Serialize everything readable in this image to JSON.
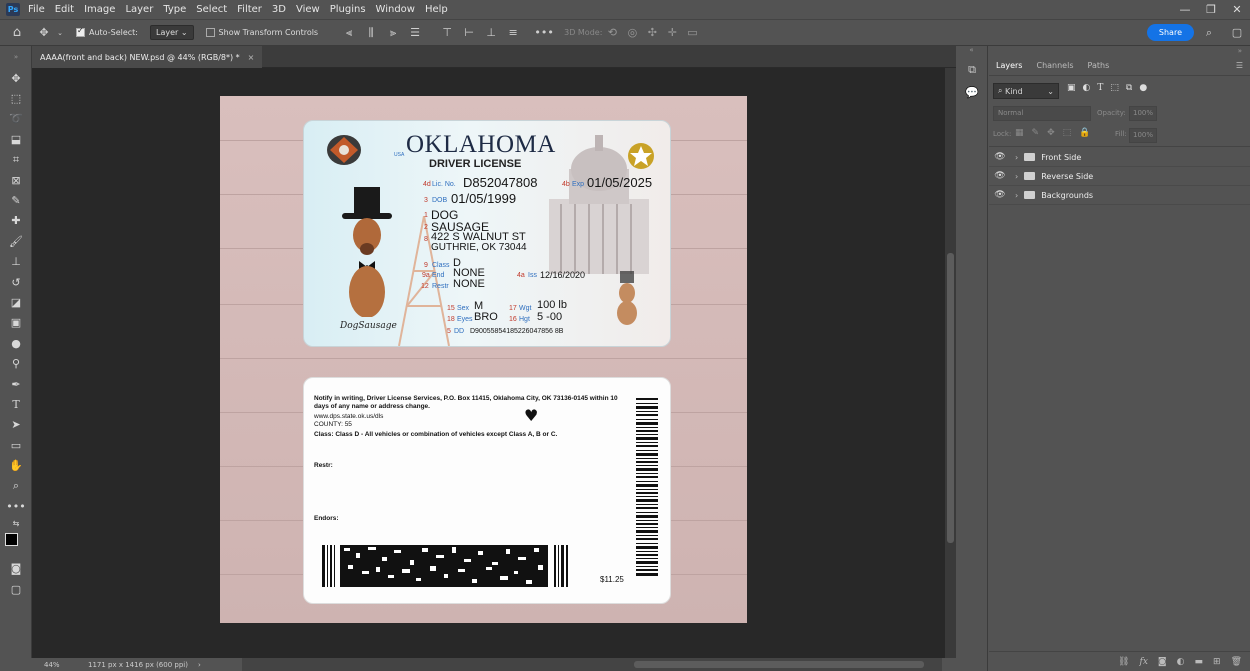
{
  "app": {
    "logo": "Ps"
  },
  "menu": [
    "File",
    "Edit",
    "Image",
    "Layer",
    "Type",
    "Select",
    "Filter",
    "3D",
    "View",
    "Plugins",
    "Window",
    "Help"
  ],
  "window_controls": [
    "—",
    "❐",
    "✕"
  ],
  "options": {
    "auto_select_label": "Auto-Select:",
    "auto_select_value": "Layer",
    "transform_label": "Show Transform Controls",
    "mode_3d": "3D Mode:",
    "share": "Share",
    "more": "•••"
  },
  "document": {
    "tab_title": "AAAA(front and back) NEW.psd @ 44% (RGB/8*) *",
    "close": "×"
  },
  "status": {
    "zoom": "44%",
    "dimensions": "1171 px x 1416 px (600 ppi)",
    "arrow": "›"
  },
  "id_front": {
    "state": "OKLAHOMA",
    "usa": "USA",
    "subtitle": "DRIVER LICENSE",
    "lic_num_code": "4d",
    "lic_label": "Lic. No.",
    "lic_no": "D852047808",
    "exp_code": "4b",
    "exp_label": "Exp",
    "exp": "01/05/2025",
    "dob_code": "3",
    "dob_label": "DOB",
    "dob": "01/05/1999",
    "n1": "1",
    "last_name": "DOG",
    "n2": "2",
    "first_name": "SAUSAGE",
    "n8": "8",
    "address1": "422 S WALNUT ST",
    "address2": "GUTHRIE, OK 73044",
    "class_code": "9",
    "class_label": "Class",
    "class": "D",
    "end_code": "9a",
    "end_label": "End",
    "endorsements": "NONE",
    "restr_code": "12",
    "restr_label": "Restr",
    "restrictions": "NONE",
    "iss_code": "4a",
    "iss_label": "Iss",
    "iss": "12/16/2020",
    "sex_code": "15",
    "sex_label": "Sex",
    "sex": "M",
    "wgt_code": "17",
    "wgt_label": "Wgt",
    "wgt": "100 lb",
    "eyes_code": "18",
    "eyes_label": "Eyes",
    "eyes": "BRO",
    "hgt_code": "16",
    "hgt_label": "Hgt",
    "hgt": "5 -00",
    "dd_code": "5",
    "dd_label": "DD",
    "dd": "D90055854185226047856 8B",
    "signature": "DogSausage"
  },
  "id_back": {
    "notice": "Notify in writing, Driver License Services, P.O. Box 11415, Oklahoma City, OK 73136-0145 within 10 days of any name or address change.",
    "url": "www.dps.state.ok.us/dls",
    "county": "COUNTY: 55",
    "class_desc": "Class: Class D - All vehicles or combination of vehicles except Class A, B or C.",
    "restr": "Restr:",
    "endors": "Endors:",
    "price": "$11.25",
    "heart": "♥"
  },
  "panels": {
    "tabs": [
      "Layers",
      "Channels",
      "Paths"
    ],
    "kind": "Kind",
    "blend": "Normal",
    "opacity_label": "Opacity:",
    "opacity": "100%",
    "lock_label": "Lock:",
    "fill_label": "Fill:",
    "fill": "100%"
  },
  "layers": [
    {
      "name": "Front Side"
    },
    {
      "name": "Reverse Side"
    },
    {
      "name": "Backgrounds"
    }
  ]
}
